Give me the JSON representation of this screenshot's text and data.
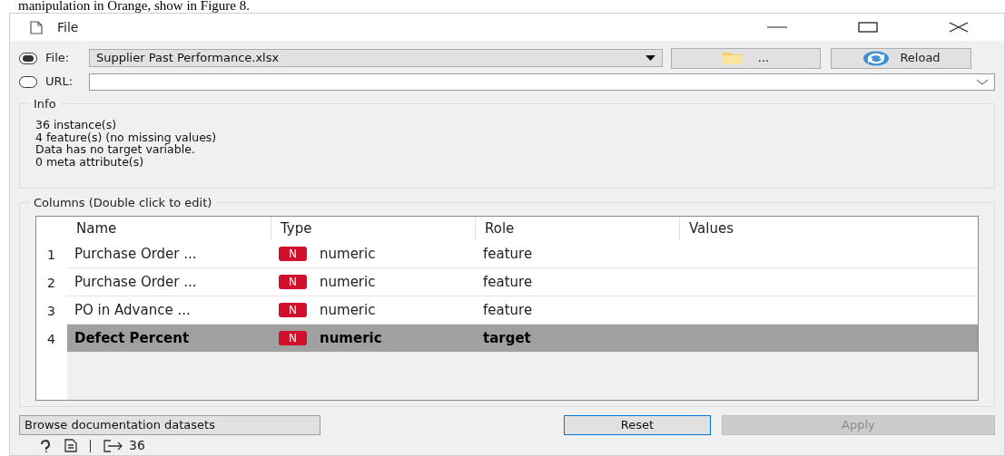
{
  "document_text": "manipulation in Orange, show in Figure 8.",
  "window": {
    "title": "File"
  },
  "source": [
    {
      "label": "File:",
      "selected": true,
      "kind": "combo",
      "value": "Supplier Past Performance.xlsx"
    },
    {
      "label": "URL:",
      "selected": false,
      "kind": "editable"
    }
  ],
  "browse_button": "...",
  "reload_button": "Reload",
  "info": {
    "title": "Info",
    "lines": [
      "36 instance(s)",
      "4 feature(s) (no missing values)",
      "Data has no target variable.",
      "0 meta attribute(s)"
    ]
  },
  "columns": {
    "title": "Columns (Double click to edit)",
    "headers": [
      "Name",
      "Type",
      "Role",
      "Values"
    ],
    "rows": [
      {
        "index": "1",
        "name": "Purchase Order ...",
        "type_badge": "N",
        "type": "numeric",
        "role": "feature",
        "selected": false
      },
      {
        "index": "2",
        "name": "Purchase Order ...",
        "type_badge": "N",
        "type": "numeric",
        "role": "feature",
        "selected": false
      },
      {
        "index": "3",
        "name": "PO in Advance ...",
        "type_badge": "N",
        "type": "numeric",
        "role": "feature",
        "selected": false
      },
      {
        "index": "4",
        "name": "Defect Percent",
        "type_badge": "N",
        "type": "numeric",
        "role": "target",
        "selected": true
      }
    ]
  },
  "buttons": [
    {
      "label": "Browse documentation datasets",
      "kind": "browse",
      "disabled": false
    },
    {
      "label": "Reset",
      "kind": "reset",
      "disabled": false
    },
    {
      "label": "Apply",
      "kind": "apply",
      "disabled": true
    }
  ],
  "status_bar": {
    "output_count": "36"
  }
}
